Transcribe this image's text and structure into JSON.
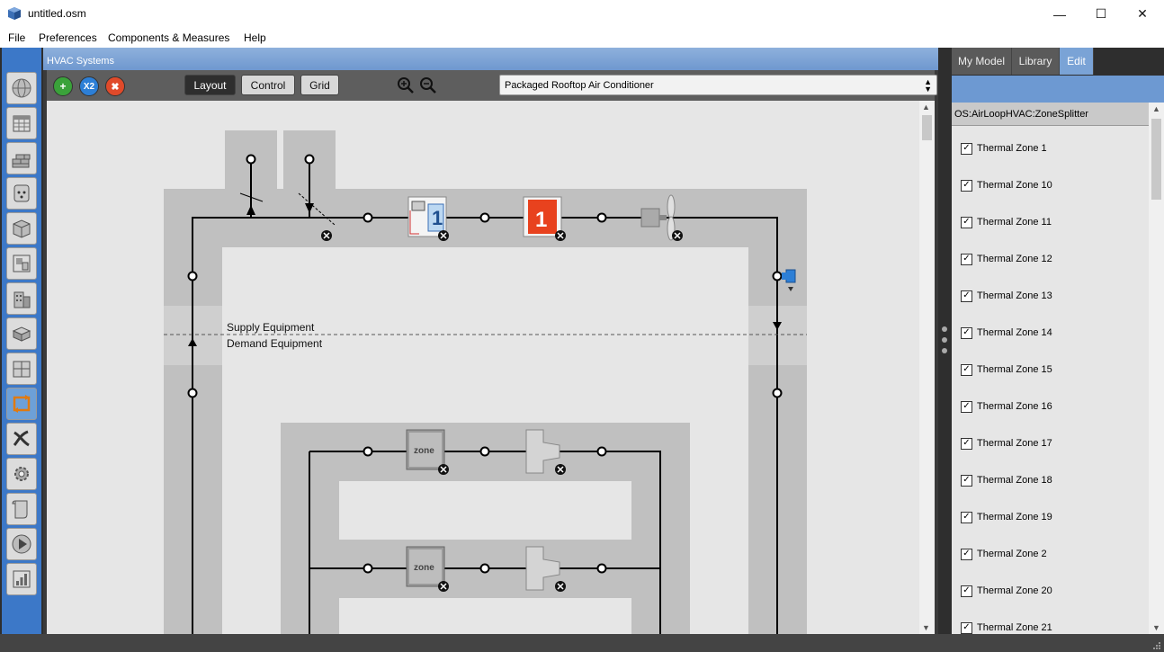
{
  "window": {
    "title": "untitled.osm",
    "controls": {
      "minimize": "—",
      "maximize": "☐",
      "close": "✕"
    }
  },
  "menu": [
    "File",
    "Preferences",
    "Components & Measures",
    "Help"
  ],
  "main": {
    "header": "HVAC Systems",
    "toolbar": {
      "add_label": "+",
      "copy_label": "X2",
      "delete_label": "✖",
      "layout": "Layout",
      "control": "Control",
      "grid": "Grid",
      "selected_system": "Packaged Rooftop Air Conditioner"
    },
    "diagram": {
      "supply_label": "Supply Equipment",
      "demand_label": "Demand Equipment",
      "zone_label": "zone"
    }
  },
  "right_panel": {
    "tabs": [
      "My Model",
      "Library",
      "Edit"
    ],
    "active_tab": "Edit",
    "inspector_title": "OS:AirLoopHVAC:ZoneSplitter",
    "zones": [
      "Thermal Zone 1",
      "Thermal Zone 10",
      "Thermal Zone 11",
      "Thermal Zone 12",
      "Thermal Zone 13",
      "Thermal Zone 14",
      "Thermal Zone 15",
      "Thermal Zone 16",
      "Thermal Zone 17",
      "Thermal Zone 18",
      "Thermal Zone 19",
      "Thermal Zone 2",
      "Thermal Zone 20",
      "Thermal Zone 21"
    ]
  },
  "colors": {
    "accent_blue": "#6d99d2",
    "add_green": "#3aa23a",
    "copy_blue": "#2d7fd6",
    "delete_red": "#e04a2a"
  },
  "left_nav_icons": [
    "site-icon",
    "schedules-icon",
    "constructions-icon",
    "loads-icon",
    "space-types-icon",
    "geometry-icon",
    "facility-icon",
    "spaces-icon",
    "thermal-zones-icon",
    "hvac-systems-icon",
    "variables-icon",
    "simulation-settings-icon",
    "scripts-icon",
    "run-icon",
    "results-icon"
  ]
}
